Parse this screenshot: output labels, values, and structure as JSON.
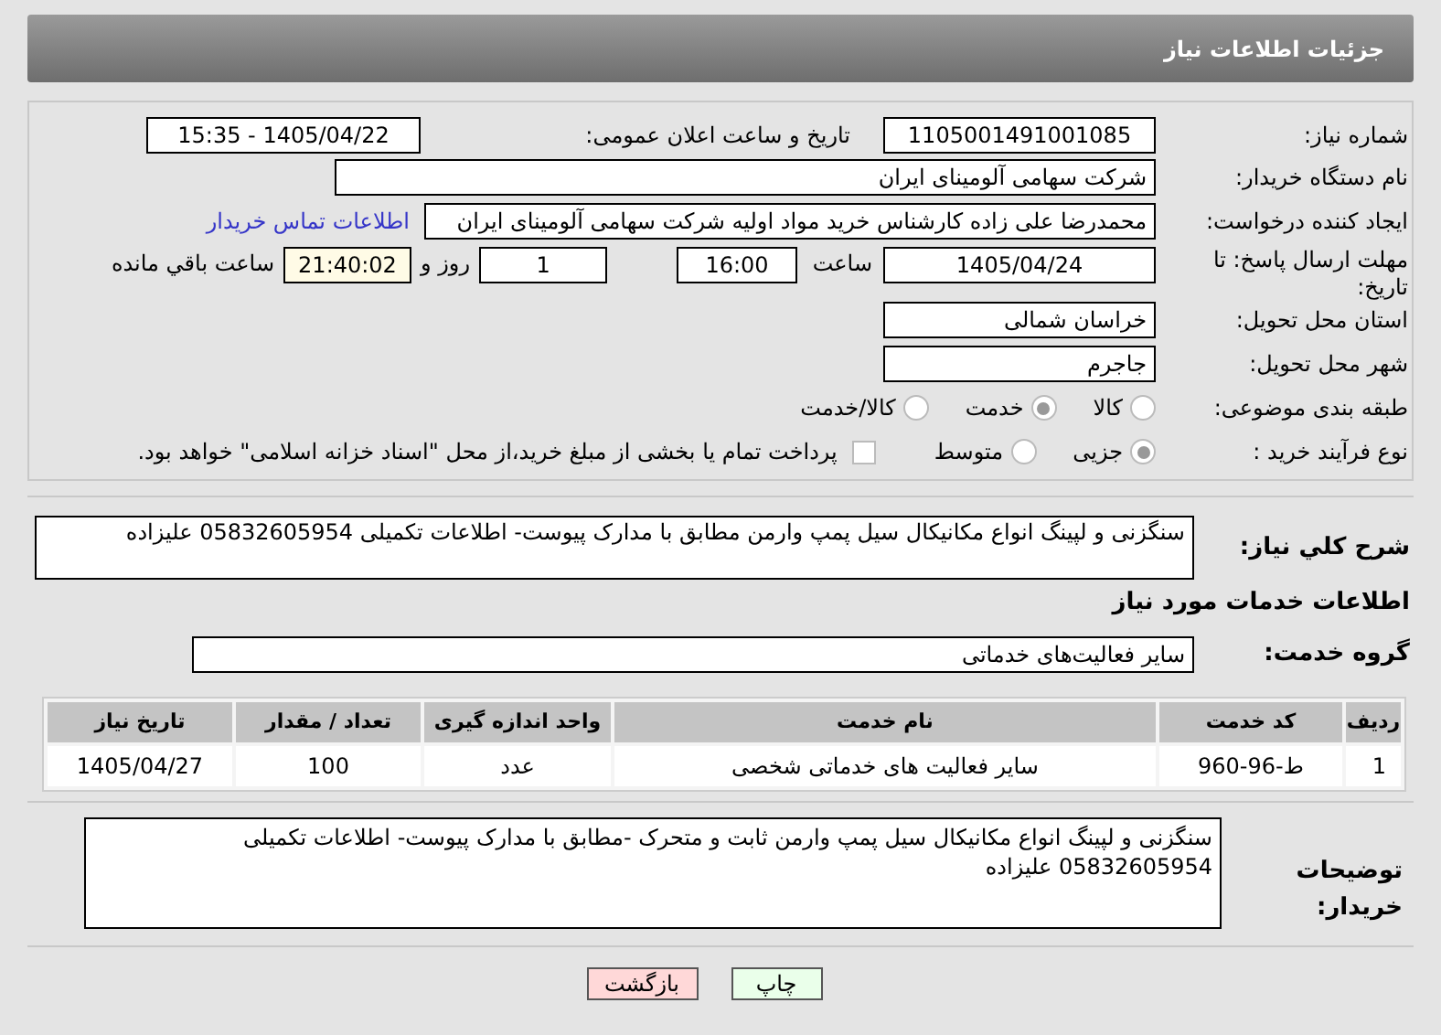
{
  "title": "جزئیات اطلاعات نیاز",
  "need_number": {
    "label": "شماره نیاز:",
    "value": "1105001491001085"
  },
  "announce": {
    "label": "تاریخ و ساعت اعلان عمومی:",
    "value": "1405/04/22 - 15:35"
  },
  "buyer_org": {
    "label": "نام دستگاه خریدار:",
    "value": "شرکت سهامی آلومینای ایران"
  },
  "requester": {
    "label": "ایجاد کننده درخواست:",
    "value": "محمدرضا علی زاده کارشناس خرید مواد اولیه شرکت سهامی آلومینای ایران"
  },
  "contact_link": "اطلاعات تماس خریدار",
  "deadline": {
    "label": "مهلت ارسال پاسخ: تا تاریخ:",
    "date": "1405/04/24",
    "time_label": "ساعت",
    "time": "16:00",
    "days": "1",
    "days_label": "روز و",
    "remaining": "21:40:02",
    "remaining_label": "ساعت باقي مانده"
  },
  "province": {
    "label": "استان محل تحویل:",
    "value": "خراسان شمالی"
  },
  "city": {
    "label": "شهر محل تحویل:",
    "value": "جاجرم"
  },
  "category": {
    "label": "طبقه بندی موضوعی:",
    "options": [
      {
        "label": "کالا",
        "selected": false
      },
      {
        "label": "خدمت",
        "selected": true
      },
      {
        "label": "کالا/خدمت",
        "selected": false
      }
    ]
  },
  "process": {
    "label": "نوع فرآیند خرید :",
    "options": [
      {
        "label": "جزیی",
        "selected": true
      },
      {
        "label": "متوسط",
        "selected": false
      }
    ],
    "payment": {
      "label": "پرداخت تمام یا بخشی از مبلغ خرید،از محل \"اسناد خزانه اسلامی\" خواهد بود.",
      "checked": false
    }
  },
  "description": {
    "label": "شرح کلي نياز:",
    "value": "سنگزنی و لپینگ انواع مکانیکال سیل پمپ وارمن مطابق با مدارک پیوست- اطلاعات تکمیلی 05832605954 علیزاده"
  },
  "services_heading": "اطلاعات خدمات مورد نیاز",
  "service_group": {
    "label": "گروه خدمت:",
    "value": "سایر فعالیت‌های خدماتی"
  },
  "table": {
    "columns": [
      "ردیف",
      "کد خدمت",
      "نام خدمت",
      "واحد اندازه گیری",
      "تعداد / مقدار",
      "تاریخ نیاز"
    ],
    "rows": [
      [
        "1",
        "ط-96-960",
        "سایر فعالیت های خدماتی شخصی",
        "عدد",
        "100",
        "1405/04/27"
      ]
    ]
  },
  "buyer_notes": {
    "label": "توضیحات خریدار:",
    "value": "سنگزنی و لپینگ انواع مکانیکال سیل پمپ وارمن ثابت و متحرک -مطابق با مدارک پیوست- اطلاعات تکمیلی 05832605954 علیزاده"
  },
  "buttons": [
    {
      "label": "چاپ",
      "kind": "print"
    },
    {
      "label": "بازگشت",
      "kind": "back"
    }
  ]
}
